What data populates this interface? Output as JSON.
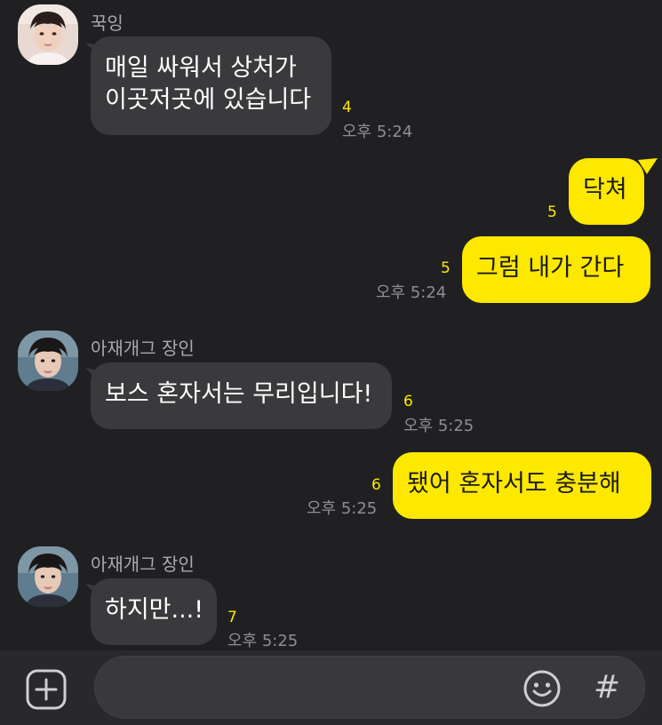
{
  "messages": [
    {
      "type": "in",
      "sender": "꾹잉",
      "lines": [
        "매일 싸워서 상처가",
        "이곳저곳에 있습니다"
      ],
      "count": "4",
      "time": "오후 5:24"
    },
    {
      "type": "out",
      "text": "닥쳐",
      "count": "5"
    },
    {
      "type": "out",
      "text": "그럼 내가 간다",
      "count": "5",
      "time": "오후 5:24"
    },
    {
      "type": "in",
      "sender": "아재개그 장인",
      "text": "보스 혼자서는 무리입니다!",
      "count": "6",
      "time": "오후 5:25"
    },
    {
      "type": "out",
      "text": "됐어 혼자서도 충분해",
      "count": "6",
      "time": "오후 5:25"
    },
    {
      "type": "in",
      "sender": "아재개그 장인",
      "text": "하지만...!",
      "count": "7",
      "time": "오후 5:25"
    }
  ],
  "input": {
    "value": "",
    "hash_label": "#"
  },
  "icons": {
    "add": "plus-square-icon",
    "emoji": "smiley-icon",
    "hash": "hash-icon"
  },
  "colors": {
    "background": "#202022",
    "incoming_bubble": "#3a3a3d",
    "outgoing_bubble": "#fde800",
    "unread_count": "#fde800"
  }
}
